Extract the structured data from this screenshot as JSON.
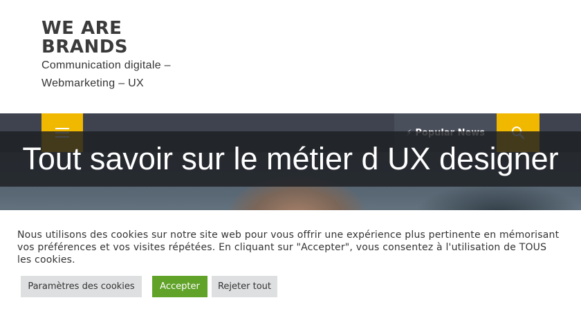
{
  "site": {
    "brand_line1": "WE ARE",
    "brand_line2": "BRANDS",
    "tagline": "Communication digitale – Webmarketing – UX"
  },
  "nav": {
    "popular_label": "Popular News"
  },
  "article": {
    "title": "Tout savoir sur le métier d UX designer"
  },
  "cookie_banner": {
    "text": "Nous utilisons des cookies sur notre site web pour vous offrir une expérience plus pertinente en mémorisant vos préférences et vos visites répétées. En cliquant sur \"Accepter\", vous consentez à l'utilisation de TOUS les cookies.",
    "settings_label": "Paramètres des cookies",
    "accept_label": "Accepter",
    "reject_label": "Rejeter tout"
  },
  "colors": {
    "accent_yellow": "#f1b800",
    "navbar": "#3e434f",
    "accept_green": "#61a229",
    "brand_text": "#3a3a3a"
  },
  "icons": [
    "hamburger-menu-icon",
    "lightning-icon",
    "search-icon"
  ]
}
